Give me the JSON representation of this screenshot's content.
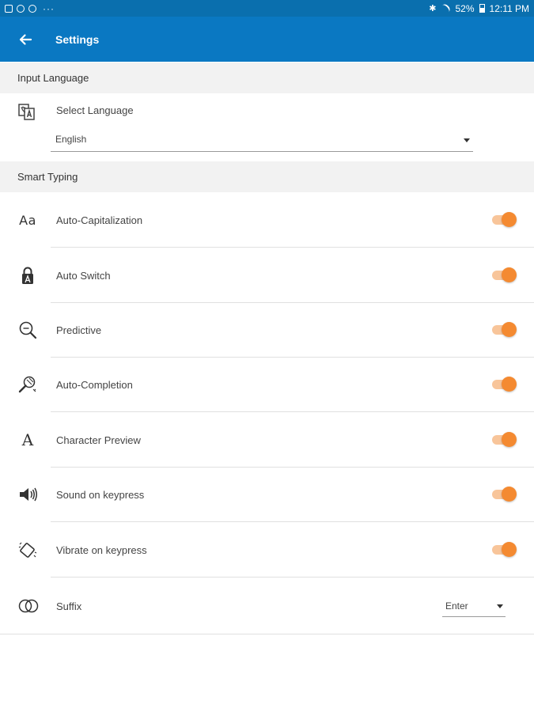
{
  "status_bar": {
    "battery": "52%",
    "time": "12:11 PM",
    "more": "···"
  },
  "app_bar": {
    "title": "Settings"
  },
  "input_language": {
    "header": "Input Language",
    "select_label": "Select Language",
    "selected": "English"
  },
  "smart_typing": {
    "header": "Smart Typing",
    "items": [
      {
        "label": "Auto-Capitalization",
        "icon": "aa-text-icon",
        "on": true
      },
      {
        "label": "Auto Switch",
        "icon": "keyboard-lock-icon",
        "on": true
      },
      {
        "label": "Predictive",
        "icon": "magnifier-icon",
        "on": true
      },
      {
        "label": "Auto-Completion",
        "icon": "magic-wand-icon",
        "on": true
      },
      {
        "label": "Character Preview",
        "icon": "letter-a-icon",
        "on": true
      },
      {
        "label": "Sound on keypress",
        "icon": "speaker-icon",
        "on": true
      },
      {
        "label": "Vibrate on keypress",
        "icon": "vibrate-icon",
        "on": true
      }
    ],
    "suffix": {
      "label": "Suffix",
      "icon": "rings-icon",
      "selected": "Enter"
    }
  },
  "colors": {
    "app_bar": "#0a78c2",
    "status_bar": "#0a6fae",
    "toggle_thumb": "#f48a31",
    "toggle_track": "#f8c59a",
    "section_bg": "#f2f2f2"
  }
}
